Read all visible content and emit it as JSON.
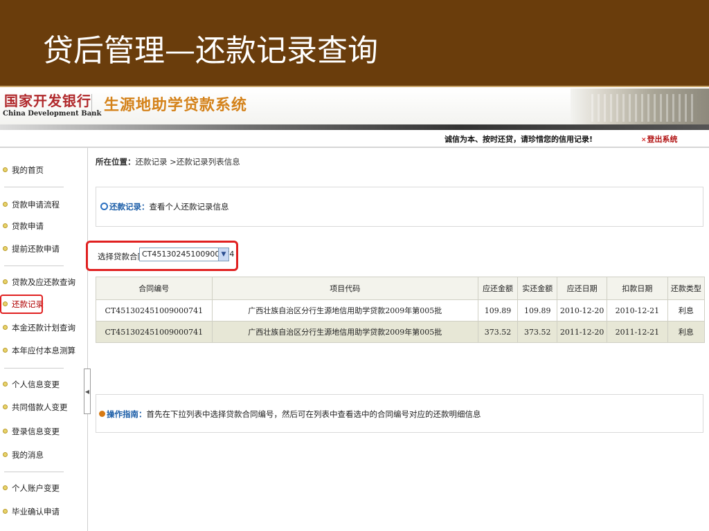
{
  "slide": {
    "title": "贷后管理—还款记录查询"
  },
  "header": {
    "bank_name_cn": "国家开发银行",
    "bank_name_en": "China Development Bank",
    "system_name": "生源地助学贷款系统",
    "integrity_notice": "诚信为本、按时还贷，请珍惜您的信用记录!",
    "logout": "登出系统"
  },
  "sidebar": {
    "items": [
      "我的首页",
      "贷款申请流程",
      "贷款申请",
      "提前还款申请",
      "贷款及应还款查询",
      "还款记录",
      "本金还款计划查询",
      "本年应付本息测算",
      "个人信息变更",
      "共同借款人变更",
      "登录信息变更",
      "我的消息",
      "个人账户变更",
      "毕业确认申请"
    ],
    "active_item": "还款记录"
  },
  "breadcrumb": {
    "label": "所在位置：",
    "path": "还款记录 >还款记录列表信息"
  },
  "record_panel": {
    "title": "还款记录：",
    "text": "查看个人还款记录信息"
  },
  "contract_select": {
    "label": "选择贷款合同",
    "value": "CT45130245100900074"
  },
  "table": {
    "headers": [
      "合同编号",
      "项目代码",
      "应还金额",
      "实还金额",
      "应还日期",
      "扣款日期",
      "还款类型"
    ],
    "rows": [
      [
        "CT451302451009000741",
        "广西壮族自治区分行生源地信用助学贷款2009年第005批",
        "109.89",
        "109.89",
        "2010-12-20",
        "2010-12-21",
        "利息"
      ],
      [
        "CT451302451009000741",
        "广西壮族自治区分行生源地信用助学贷款2009年第005批",
        "373.52",
        "373.52",
        "2011-12-20",
        "2011-12-21",
        "利息"
      ]
    ]
  },
  "guide": {
    "title": "操作指南：",
    "text": "首先在下拉列表中选择贷款合同编号，然后可在列表中查看选中的合同编号对应的还款明细信息"
  },
  "colors": {
    "slide_bar": "#6a3d0c",
    "highlight_red": "#e02020",
    "accent_blue": "#1c5ea8",
    "bank_red": "#b0282b",
    "system_orange": "#d4821a"
  },
  "icons": {
    "collapse_handle": "chevron-left-icon",
    "select_arrow": "chevron-down-icon",
    "logout": "close-icon"
  }
}
